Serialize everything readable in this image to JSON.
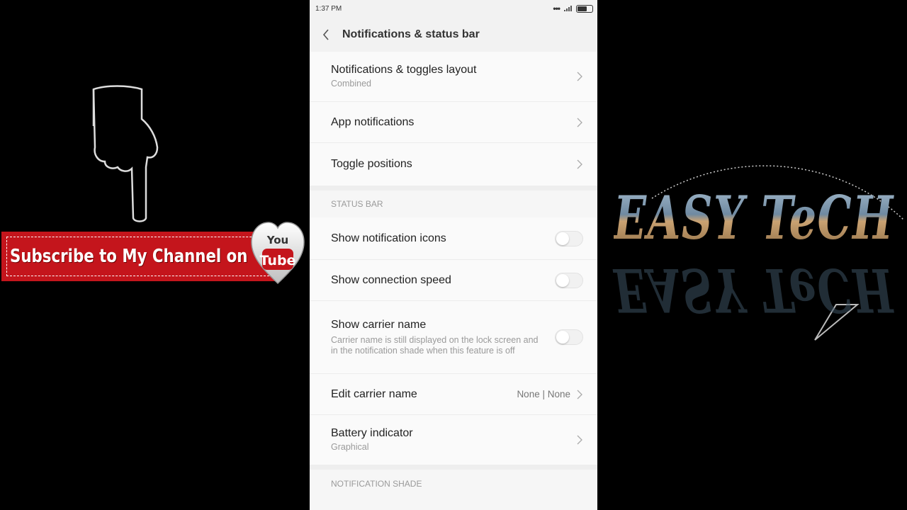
{
  "overlay": {
    "subscribe_text": "Subscribe to My Channel on",
    "youtube_you": "You",
    "youtube_tube": "Tube",
    "brand": "EASY TeCH"
  },
  "status": {
    "time": "1:37 PM"
  },
  "header": {
    "title": "Notifications & status bar"
  },
  "items": {
    "layout": {
      "label": "Notifications & toggles layout",
      "sub": "Combined"
    },
    "app_notifications": {
      "label": "App notifications"
    },
    "toggle_positions": {
      "label": "Toggle positions"
    }
  },
  "status_bar_section": {
    "header": "STATUS BAR",
    "show_notification_icons": {
      "label": "Show notification icons",
      "on": false
    },
    "show_connection_speed": {
      "label": "Show connection speed",
      "on": false
    },
    "show_carrier_name": {
      "label": "Show carrier name",
      "sub": "Carrier name is still displayed on the lock screen and in the notification shade when this feature is off",
      "on": false
    },
    "edit_carrier_name": {
      "label": "Edit carrier name",
      "value": "None | None"
    },
    "battery_indicator": {
      "label": "Battery indicator",
      "sub": "Graphical"
    }
  },
  "notification_shade_section": {
    "header": "NOTIFICATION SHADE"
  },
  "colors": {
    "banner_red": "#c4151c",
    "page_bg": "#f6f6f6"
  }
}
